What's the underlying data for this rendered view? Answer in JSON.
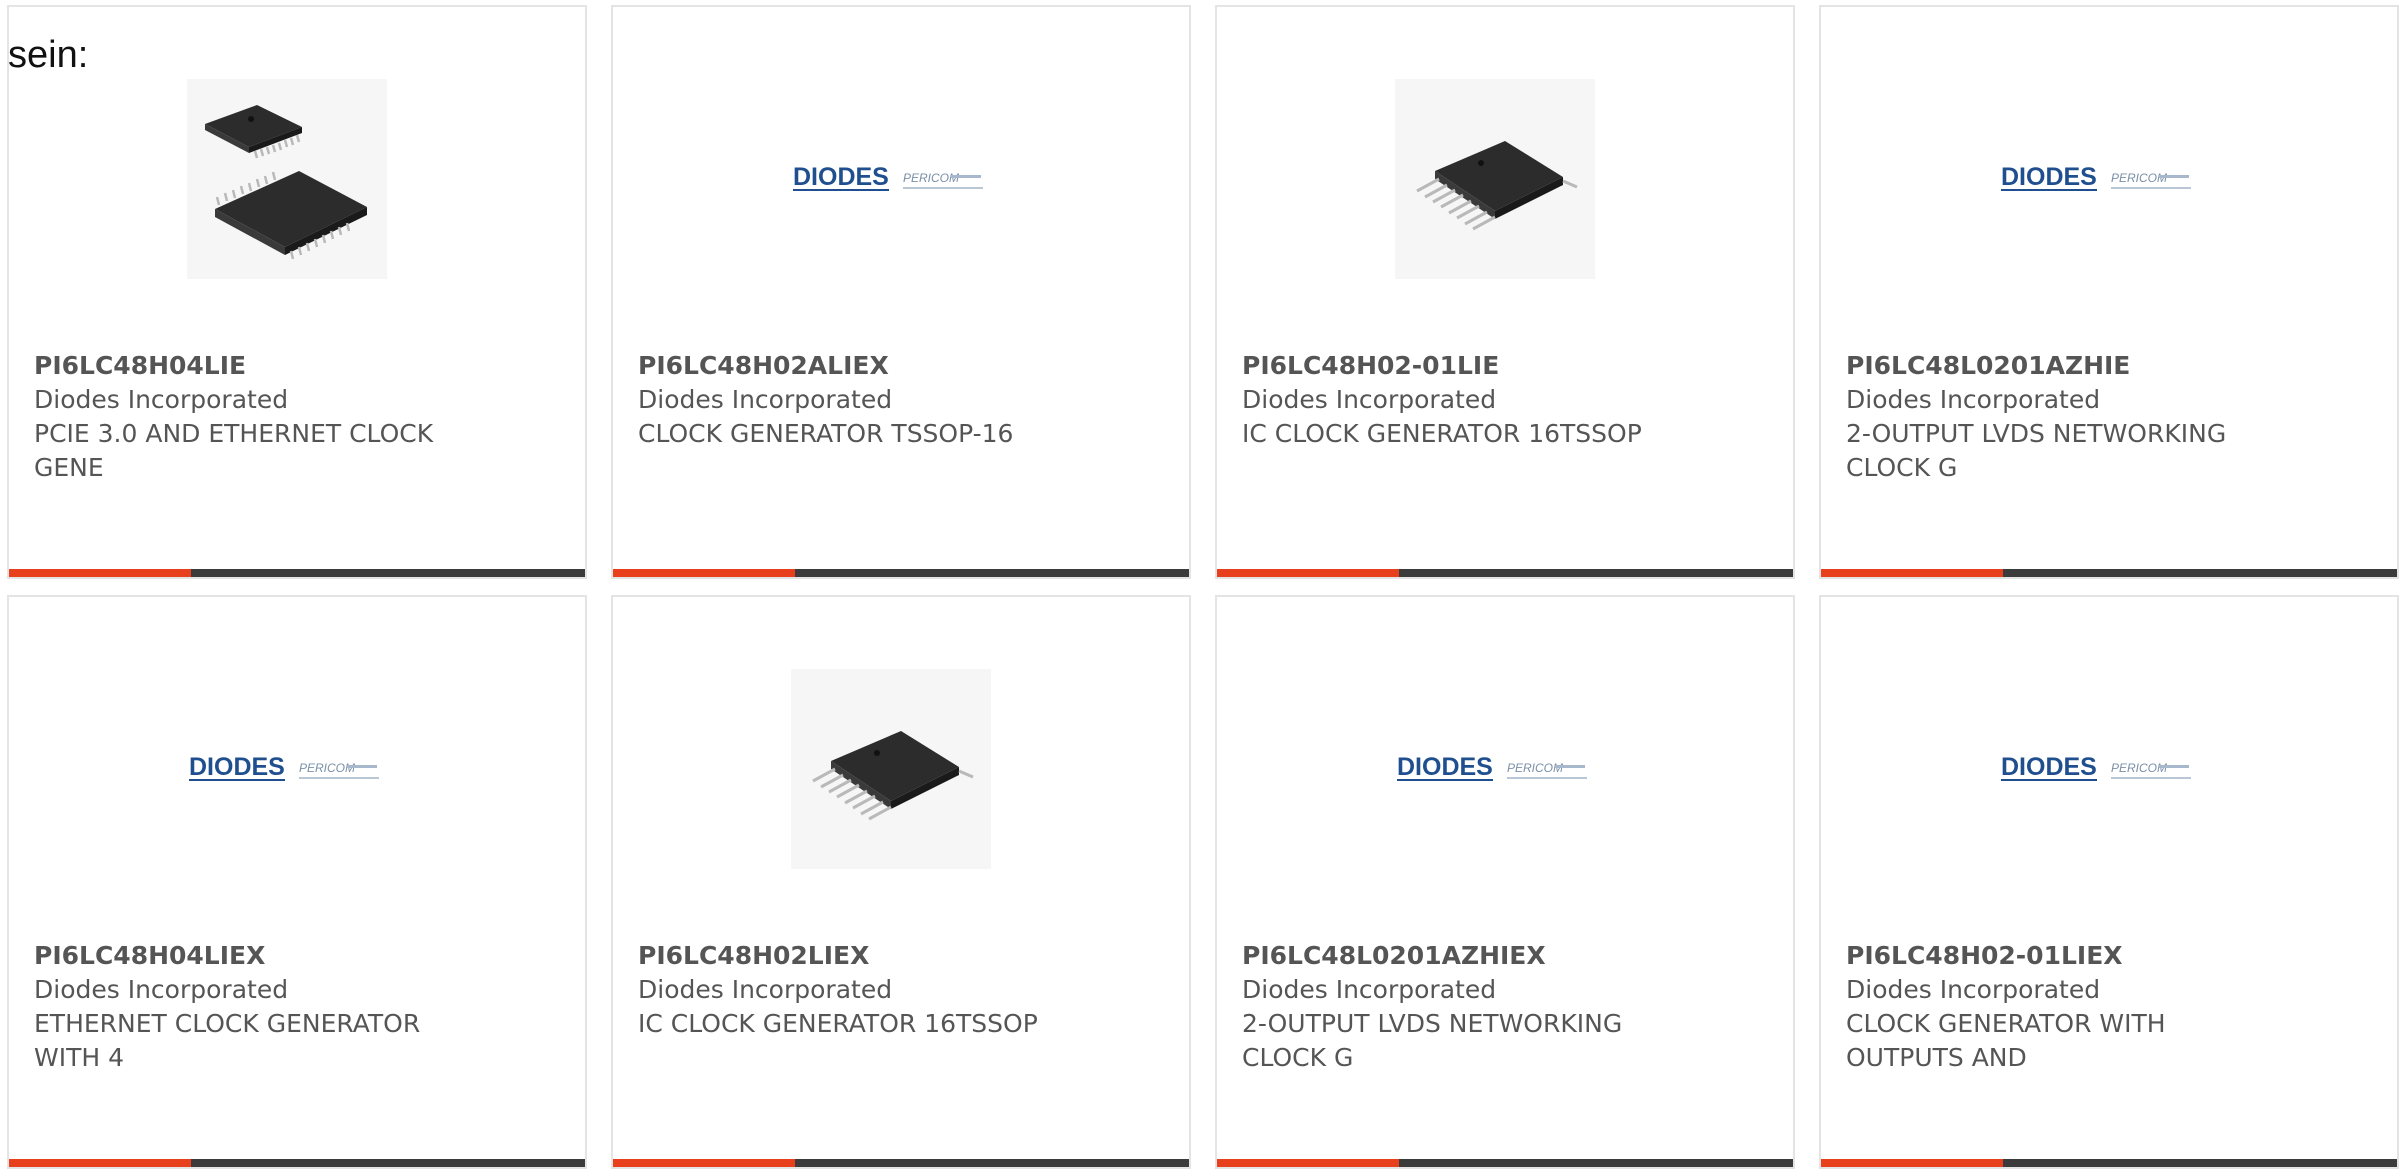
{
  "page": {
    "prefix_text": "sein:"
  },
  "colors": {
    "accent": "#e8401c",
    "bar": "#3b3b3b",
    "text": "#555555",
    "card_border": "#e4e4e4",
    "logo_blue": "#1f4f8f"
  },
  "products": [
    {
      "part_number": "PI6LC48H04LIE",
      "manufacturer": "Diodes Incorporated",
      "description": "PCIE 3.0 AND ETHERNET CLOCK GENE",
      "image": "chip-pair-image"
    },
    {
      "part_number": "PI6LC48H02ALIEX",
      "manufacturer": "Diodes Incorporated",
      "description": "CLOCK GENERATOR TSSOP-16",
      "image": "diodes-pericom-logo",
      "logo_text": "DIODES",
      "logo_subtext": "PERICOM"
    },
    {
      "part_number": "PI6LC48H02-01LIE",
      "manufacturer": "Diodes Incorporated",
      "description": "IC CLOCK GENERATOR 16TSSOP",
      "image": "chip-image"
    },
    {
      "part_number": "PI6LC48L0201AZHIE",
      "manufacturer": "Diodes Incorporated",
      "description": "2-OUTPUT LVDS NETWORKING CLOCK G",
      "image": "diodes-pericom-logo",
      "logo_text": "DIODES",
      "logo_subtext": "PERICOM"
    },
    {
      "part_number": "PI6LC48H04LIEX",
      "manufacturer": "Diodes Incorporated",
      "description": "ETHERNET CLOCK GENERATOR WITH 4",
      "image": "diodes-pericom-logo",
      "logo_text": "DIODES",
      "logo_subtext": "PERICOM"
    },
    {
      "part_number": "PI6LC48H02LIEX",
      "manufacturer": "Diodes Incorporated",
      "description": "IC CLOCK GENERATOR 16TSSOP",
      "image": "chip-image"
    },
    {
      "part_number": "PI6LC48L0201AZHIEX",
      "manufacturer": "Diodes Incorporated",
      "description": "2-OUTPUT LVDS NETWORKING CLOCK G",
      "image": "diodes-pericom-logo",
      "logo_text": "DIODES",
      "logo_subtext": "PERICOM"
    },
    {
      "part_number": "PI6LC48H02-01LIEX",
      "manufacturer": "Diodes Incorporated",
      "description": "CLOCK GENERATOR WITH OUTPUTS AND",
      "image": "diodes-pericom-logo",
      "logo_text": "DIODES",
      "logo_subtext": "PERICOM"
    }
  ]
}
